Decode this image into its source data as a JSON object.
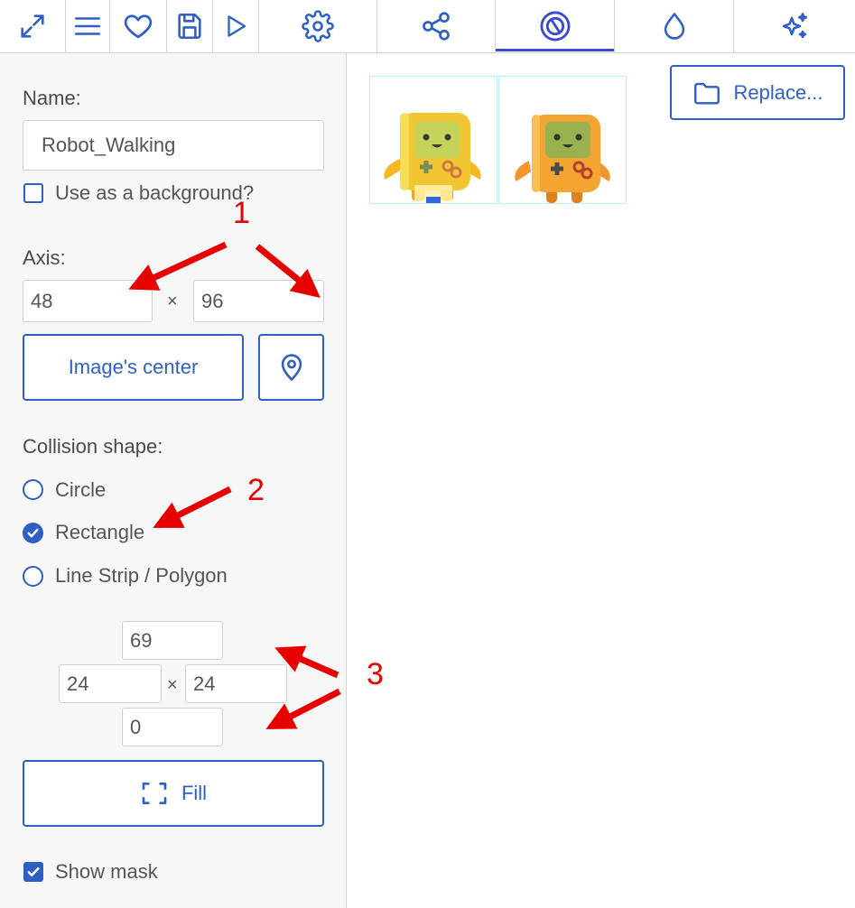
{
  "toolbar": {
    "items": [
      {
        "icon": "expand-icon"
      },
      {
        "icon": "menu-icon"
      },
      {
        "icon": "heart-icon"
      },
      {
        "icon": "save-icon"
      },
      {
        "icon": "play-icon"
      },
      {
        "icon": "gear-icon"
      },
      {
        "icon": "share-nodes-icon"
      },
      {
        "icon": "collision-mask-icon",
        "active": true
      },
      {
        "icon": "drop-icon"
      },
      {
        "icon": "sparkles-icon"
      }
    ]
  },
  "panel": {
    "name_label": "Name:",
    "name_value": "Robot_Walking",
    "background_checkbox": {
      "label": "Use as a background?",
      "checked": false
    },
    "axis_label": "Axis:",
    "axis_x": "48",
    "axis_y": "96",
    "times_symbol": "×",
    "image_center_label": "Image's center",
    "collision_label": "Collision shape:",
    "collision_options": [
      {
        "label": "Circle",
        "selected": false
      },
      {
        "label": "Rectangle",
        "selected": true
      },
      {
        "label": "Line Strip / Polygon",
        "selected": false
      }
    ],
    "rect_top": "69",
    "rect_left": "24",
    "rect_right": "24",
    "rect_bottom": "0",
    "fill_label": "Fill",
    "show_mask": {
      "label": "Show mask",
      "checked": true
    }
  },
  "canvas": {
    "replace_label": "Replace...",
    "frames": [
      "robot-frame-1",
      "robot-frame-2"
    ]
  },
  "annotations": {
    "one": "1",
    "two": "2",
    "three": "3"
  },
  "colors": {
    "accent": "#2f5fc4",
    "annotation": "#e60000"
  }
}
